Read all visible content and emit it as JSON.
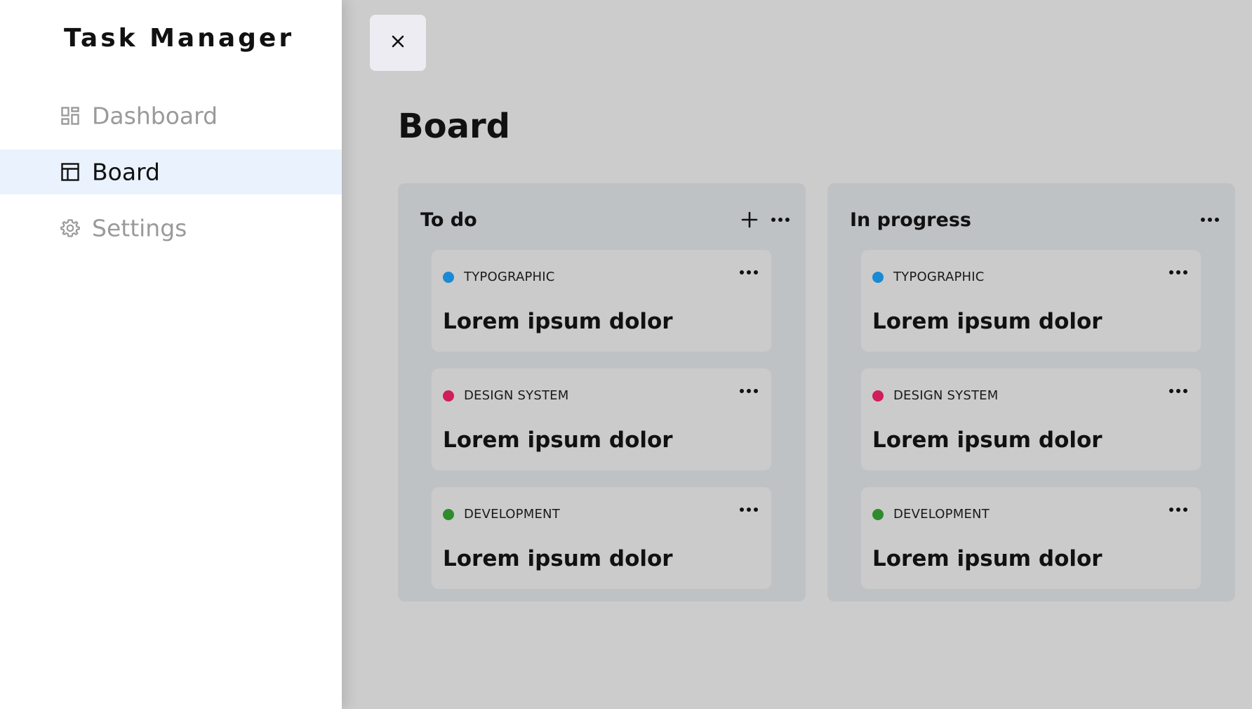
{
  "sidebar": {
    "app_title": "Task Manager",
    "items": [
      {
        "label": "Dashboard",
        "icon": "dashboard-icon",
        "active": false
      },
      {
        "label": "Board",
        "icon": "board-icon",
        "active": true
      },
      {
        "label": "Settings",
        "icon": "settings-icon",
        "active": false
      }
    ]
  },
  "main": {
    "title": "Board",
    "close_icon": "close-icon",
    "columns": [
      {
        "title": "To do",
        "cards": [
          {
            "tag": "TYPOGRAPHIC",
            "tag_color": "#1a8ad4",
            "title": "Lorem ipsum dolor"
          },
          {
            "tag": "DESIGN SYSTEM",
            "tag_color": "#d01e5a",
            "title": "Lorem ipsum dolor"
          },
          {
            "tag": "DEVELOPMENT",
            "tag_color": "#2e8b2e",
            "title": "Lorem ipsum dolor"
          }
        ]
      },
      {
        "title": "In progress",
        "cards": [
          {
            "tag": "TYPOGRAPHIC",
            "tag_color": "#1a8ad4",
            "title": "Lorem ipsum dolor"
          },
          {
            "tag": "DESIGN SYSTEM",
            "tag_color": "#d01e5a",
            "title": "Lorem ipsum dolor"
          },
          {
            "tag": "DEVELOPMENT",
            "tag_color": "#2e8b2e",
            "title": "Lorem ipsum dolor"
          }
        ]
      }
    ]
  },
  "colors": {
    "sidebar_active_bg": "#eaf2fd",
    "overlay_bg": "#cccccc",
    "column_bg": "#bfc2c5"
  }
}
